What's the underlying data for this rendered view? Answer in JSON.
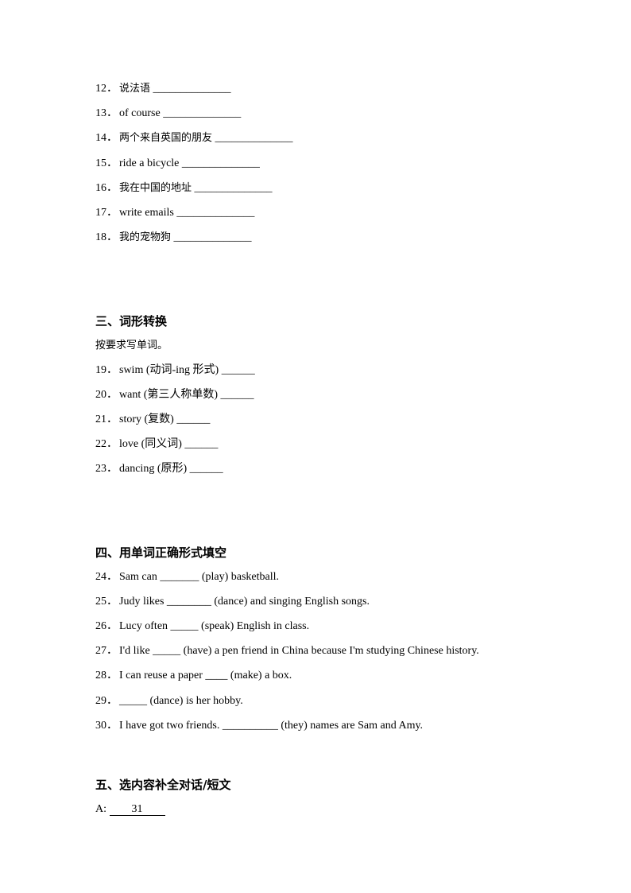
{
  "section_two_items": [
    {
      "num": "12．",
      "text": "说法语",
      "blank": " ______________",
      "cn": true
    },
    {
      "num": "13．",
      "text": "of course",
      "blank": " ______________",
      "cn": false
    },
    {
      "num": "14．",
      "text": "两个来自英国的朋友",
      "blank": " ______________",
      "cn": true
    },
    {
      "num": "15．",
      "text": "ride a bicycle",
      "blank": " ______________",
      "cn": false
    },
    {
      "num": "16．",
      "text": "我在中国的地址",
      "blank": " ______________",
      "cn": true
    },
    {
      "num": "17．",
      "text": "write emails",
      "blank": " ______________",
      "cn": false
    },
    {
      "num": "18．",
      "text": "我的宠物狗",
      "blank": " ______________",
      "cn": true
    }
  ],
  "section_three": {
    "heading": "三、词形转换",
    "instruction": "按要求写单词。",
    "items": [
      {
        "num": "19．",
        "text": "swim (动词-ing 形式) ______"
      },
      {
        "num": "20．",
        "text": "want (第三人称单数) ______"
      },
      {
        "num": "21．",
        "text": "story (复数) ______"
      },
      {
        "num": "22．",
        "text": "love (同义词) ______"
      },
      {
        "num": "23．",
        "text": "dancing (原形) ______"
      }
    ]
  },
  "section_four": {
    "heading": "四、用单词正确形式填空",
    "items": [
      {
        "num": "24．",
        "text": "Sam can _______ (play) basketball."
      },
      {
        "num": "25．",
        "text": "Judy likes ________ (dance) and singing English songs."
      },
      {
        "num": "26．",
        "text": "Lucy often _____ (speak) English in class."
      },
      {
        "num": "27．",
        "text": "I'd like _____ (have) a pen friend in China because I'm studying Chinese history."
      },
      {
        "num": "28．",
        "text": "I can reuse a paper ____ (make) a box."
      },
      {
        "num": "29．",
        "text": "_____ (dance) is her hobby."
      },
      {
        "num": "30．",
        "text": "I have got two friends. __________ (they) names are Sam and Amy."
      }
    ]
  },
  "section_five": {
    "heading": "五、选内容补全对话/短文",
    "first_line_label": "A: ",
    "first_line_blank": "31"
  }
}
